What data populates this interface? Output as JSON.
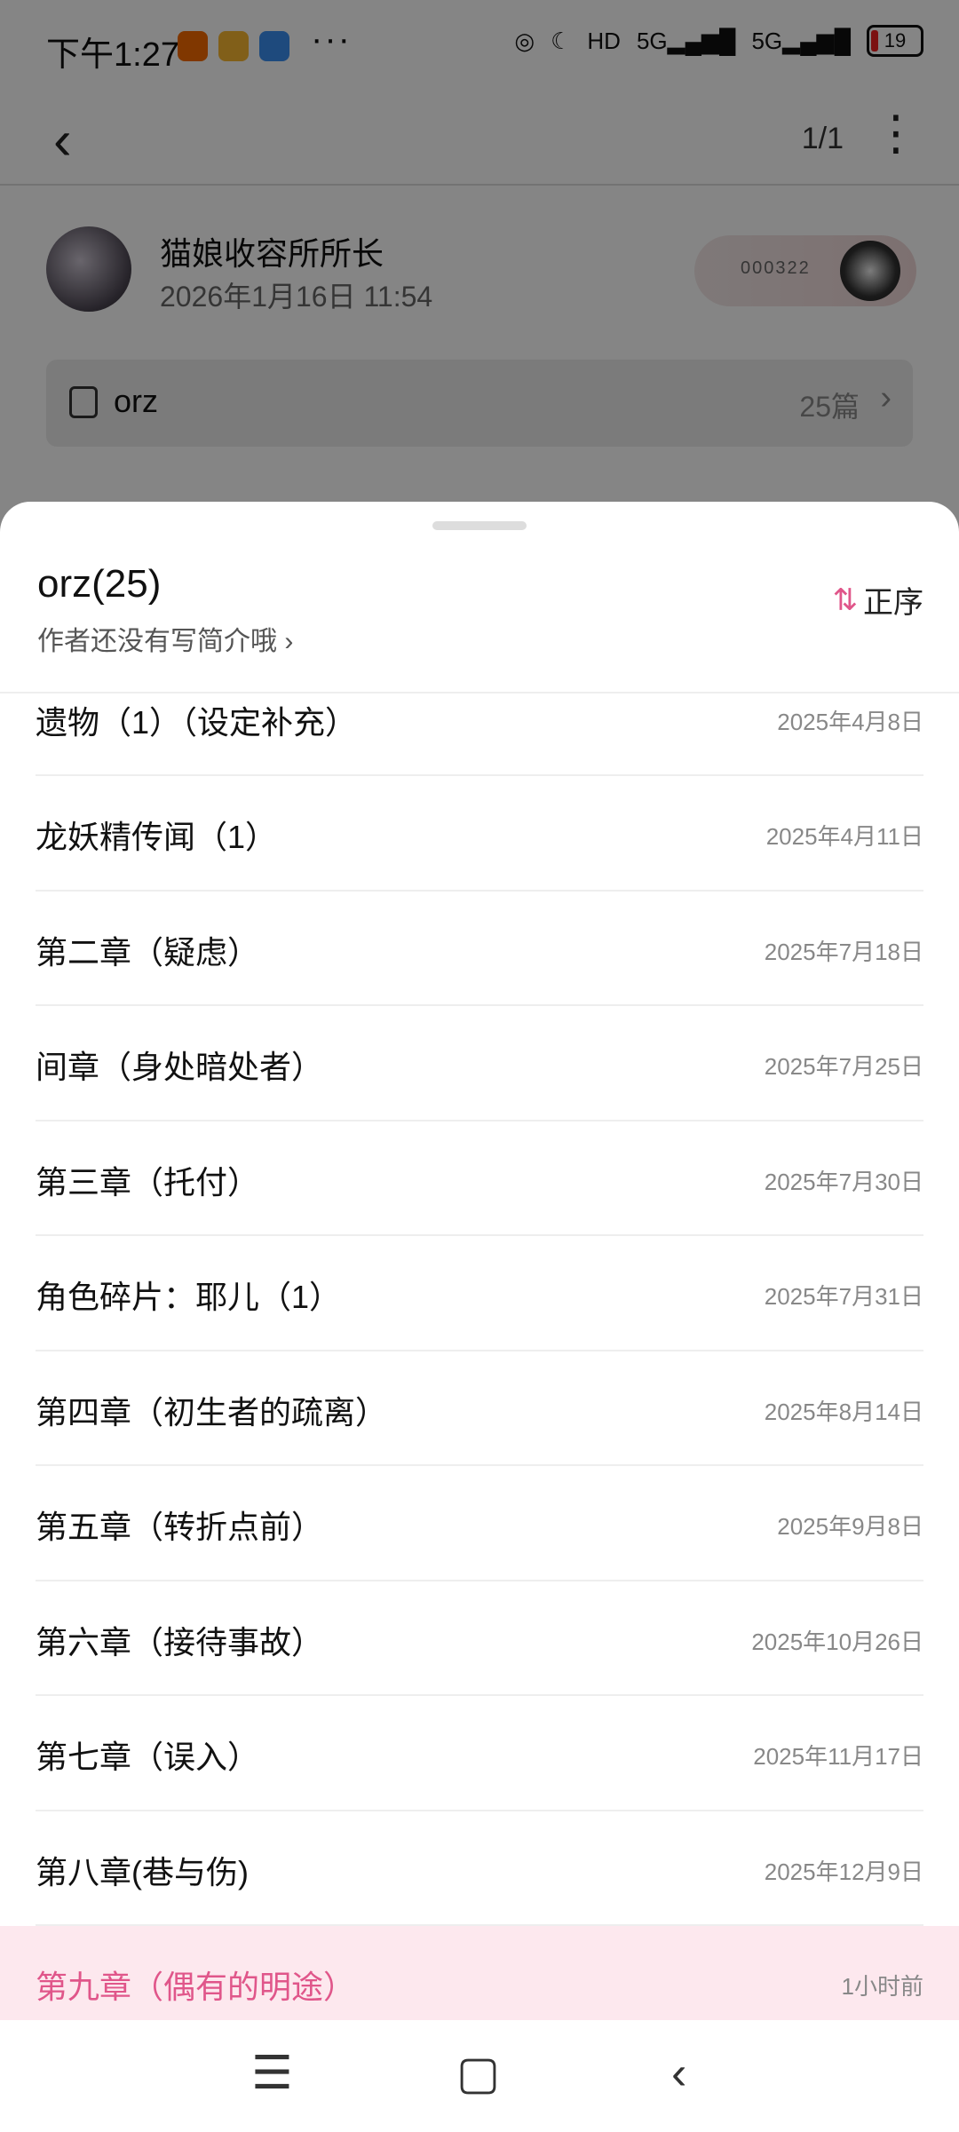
{
  "status_bar": {
    "time": "下午1:27",
    "dots": "···",
    "network": "5G",
    "battery": "19",
    "hd": "HD"
  },
  "header": {
    "page_count": "1/1"
  },
  "author": {
    "name": "猫娘收容所所长",
    "date": "2026年1月16日 11:54",
    "badge_number": "000322"
  },
  "collection": {
    "title": "orz",
    "count": "25篇"
  },
  "sheet": {
    "title": "orz(25)",
    "description": "作者还没有写简介哦",
    "sort_label": "正序"
  },
  "chapters": [
    {
      "title": "遗物（1）（设定补充）",
      "date": "2025年4月8日"
    },
    {
      "title": "龙妖精传闻（1）",
      "date": "2025年4月11日"
    },
    {
      "title": "第二章（疑虑）",
      "date": "2025年7月18日"
    },
    {
      "title": "间章（身处暗处者）",
      "date": "2025年7月25日"
    },
    {
      "title": "第三章（托付）",
      "date": "2025年7月30日"
    },
    {
      "title": "角色碎片：耶儿（1）",
      "date": "2025年7月31日"
    },
    {
      "title": "第四章（初生者的疏离）",
      "date": "2025年8月14日"
    },
    {
      "title": "第五章（转折点前）",
      "date": "2025年9月8日"
    },
    {
      "title": "第六章（接待事故）",
      "date": "2025年10月26日"
    },
    {
      "title": "第七章（误入）",
      "date": "2025年11月17日"
    },
    {
      "title": "第八章(巷与伤)",
      "date": "2025年12月9日"
    },
    {
      "title": "第九章（偶有的明途）",
      "date": "1小时前"
    }
  ],
  "colors": {
    "accent": "#e0568a",
    "current_row_bg": "#fde8ee"
  }
}
